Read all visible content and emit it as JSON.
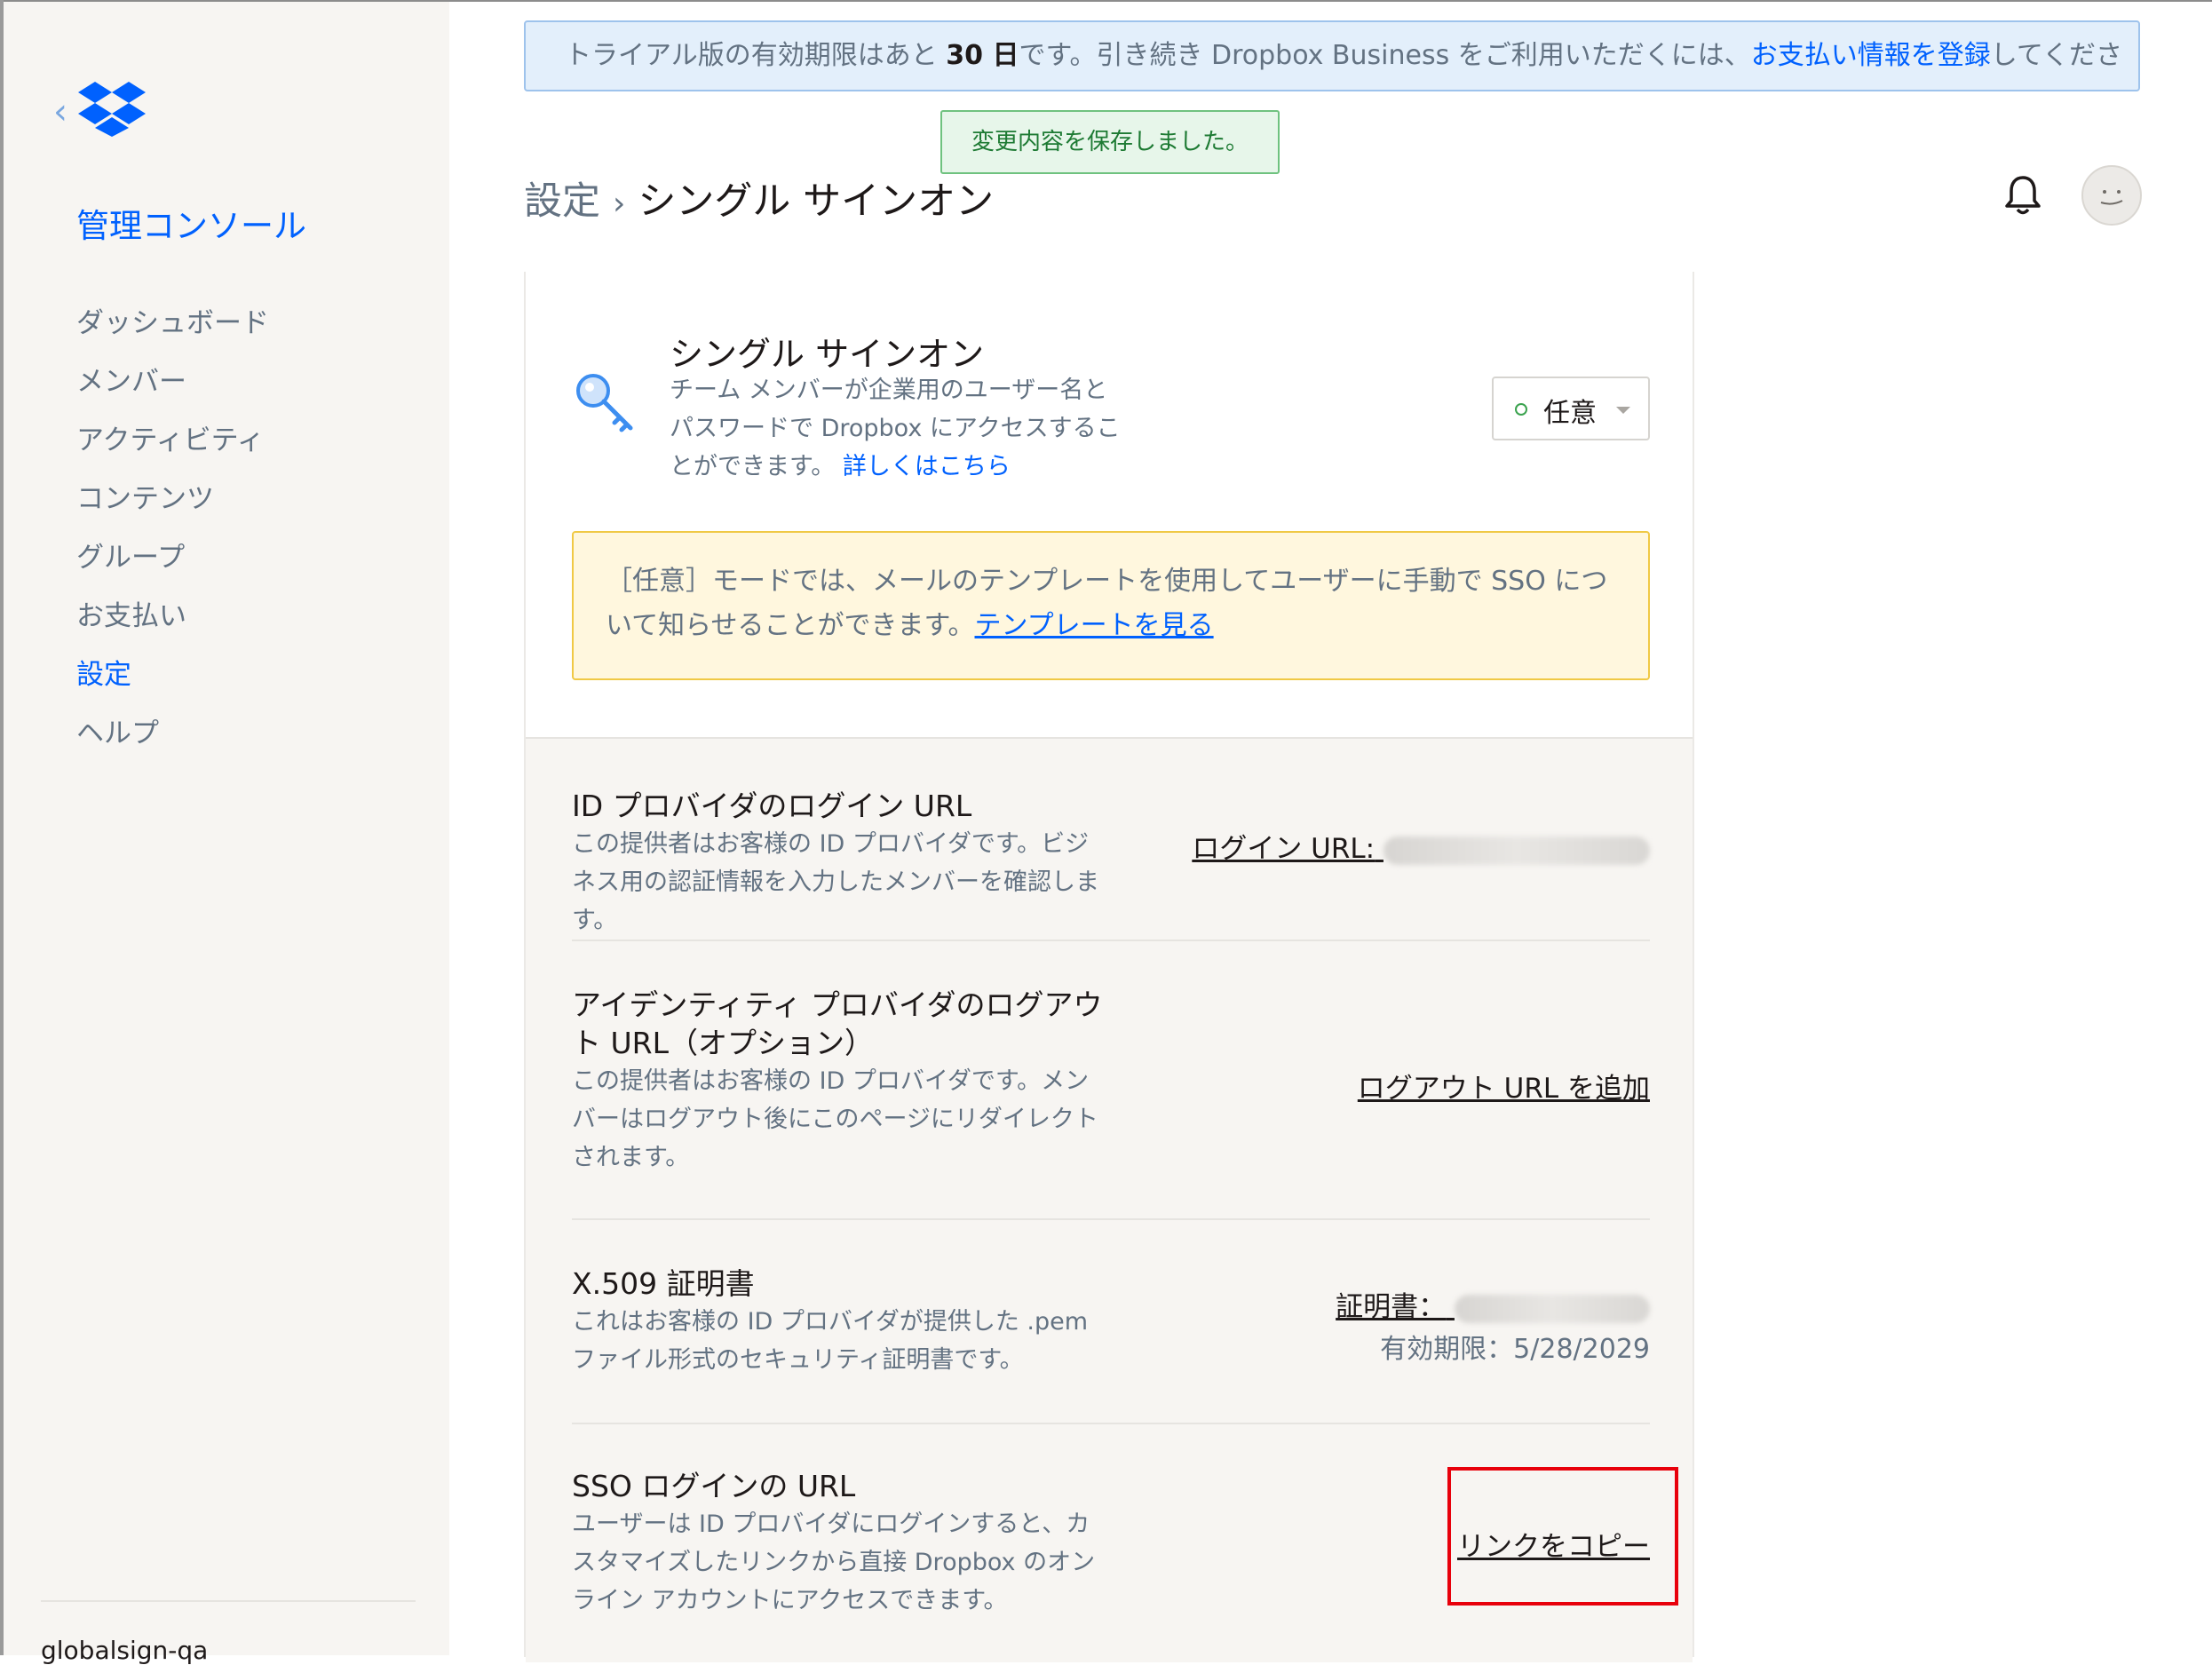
{
  "sidebar": {
    "back_icon": "chevron-left-icon",
    "logo_icon": "dropbox-logo-icon",
    "title": "管理コンソール",
    "items": [
      {
        "label": "ダッシュボード"
      },
      {
        "label": "メンバー"
      },
      {
        "label": "アクティビティ"
      },
      {
        "label": "コンテンツ"
      },
      {
        "label": "グループ"
      },
      {
        "label": "お支払い"
      },
      {
        "label": "設定",
        "active": true
      },
      {
        "label": "ヘルプ"
      }
    ],
    "team_name": "globalsign-qa"
  },
  "banner": {
    "text_before": "トライアル版の有効期限はあと ",
    "days": "30 日",
    "text_middle": "です。引き続き Dropbox Business をご利用いただくには、",
    "link": "お支払い情報を登録",
    "text_after": "してくださ"
  },
  "toast": {
    "text": "変更内容を保存しました。"
  },
  "header": {
    "crumb_parent": "設定",
    "crumb_sep": "›",
    "crumb_current": "シングル サインオン",
    "bell_icon": "bell-icon",
    "avatar_icon": "avatar-icon"
  },
  "sso": {
    "icon": "key-icon",
    "title": "シングル サインオン",
    "description": "チーム メンバーが企業用のユーザー名とパスワードで Dropbox にアクセスすることができます。",
    "learn_more": "詳しくはこちら",
    "mode_value": "任意"
  },
  "notice": {
    "text": "［任意］モードでは、メールのテンプレートを使用してユーザーに手動で SSO について知らせることができます。",
    "link": "テンプレートを見る"
  },
  "rows": {
    "login_url": {
      "title": "ID プロバイダのログイン URL",
      "description": "この提供者はお客様の ID プロバイダです。ビジネス用の認証情報を入力したメンバーを確認します。",
      "action": "ログイン URL:"
    },
    "logout_url": {
      "title": "アイデンティティ プロバイダのログアウト URL（オプション）",
      "description": "この提供者はお客様の ID プロバイダです。メンバーはログアウト後にこのページにリダイレクトされます。",
      "action": "ログアウト URL を追加"
    },
    "certificate": {
      "title": "X.509 証明書",
      "description": "これはお客様の ID プロバイダが提供した .pem ファイル形式のセキュリティ証明書です。",
      "action": "証明書：",
      "expiry": "有効期限：5/28/2029"
    },
    "sso_url": {
      "title": "SSO ログインの URL",
      "description": "ユーザーは ID プロバイダにログインすると、カスタマイズしたリンクから直接 Dropbox のオンライン アカウントにアクセスできます。",
      "action": "リンクをコピー"
    }
  }
}
